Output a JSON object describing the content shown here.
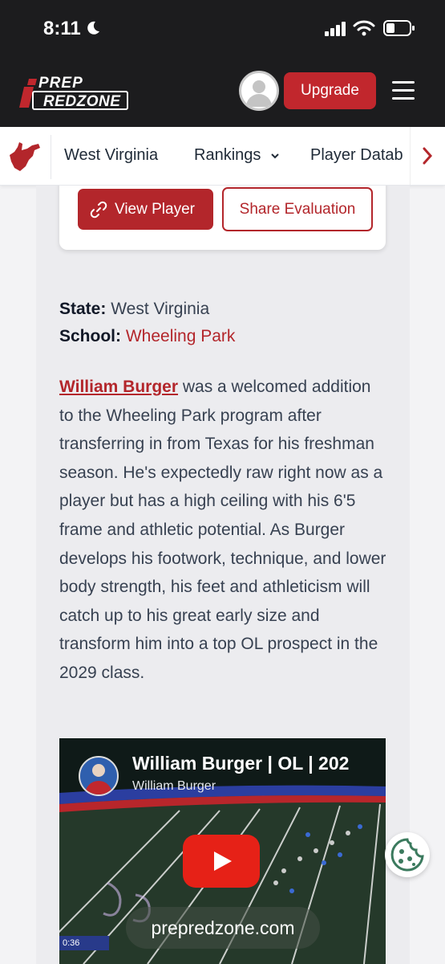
{
  "status_bar": {
    "time": "8:11",
    "icons": [
      "moon-icon",
      "signal-icon",
      "wifi-icon",
      "battery-icon"
    ]
  },
  "header": {
    "logo_top": "PREP",
    "logo_bottom": "REDZONE",
    "upgrade_label": "Upgrade",
    "icons": [
      "avatar",
      "hamburger-icon"
    ]
  },
  "sub_nav": {
    "state_label": "West Virginia",
    "rankings_label": "Rankings",
    "database_label": "Player Datab"
  },
  "card": {
    "view_player_label": "View Player",
    "share_label": "Share Evaluation"
  },
  "meta": {
    "state_key": "State:",
    "state_value": "West Virginia",
    "school_key": "School:",
    "school_value": "Wheeling Park"
  },
  "bio": {
    "player_link": "William Burger",
    "text": " was a welcomed addition to the Wheeling Park program after transferring in from Texas for his freshman season. He's expectedly raw right now as a player but has a high ceiling with his 6'5 frame and athletic potential. As Burger develops his footwork, technique, and lower body strength, his feet and athleticism will catch up to his great early size and transform him into a top OL prospect in the 2029 class."
  },
  "video": {
    "title": "William Burger | OL | 202",
    "channel": "William Burger",
    "watermark": "prepredzone.com",
    "scoreboard": "0:36"
  },
  "colors": {
    "brand_red": "#b3262b",
    "header_bg": "#1c1c1e",
    "youtube_red": "#e62117",
    "cookie_green": "#3b7a5e"
  }
}
